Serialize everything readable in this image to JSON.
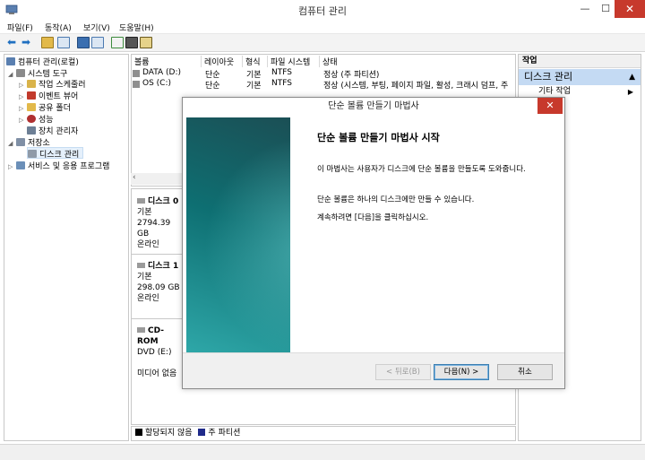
{
  "window": {
    "title": "컴퓨터 관리",
    "controls": {
      "minimize": "—",
      "maximize": "☐",
      "close": "✕"
    }
  },
  "menubar": [
    "파일(F)",
    "동작(A)",
    "보기(V)",
    "도움말(H)"
  ],
  "tree": {
    "root": "컴퓨터 관리(로컬)",
    "system_tools": "시스템 도구",
    "task_scheduler": "작업 스케줄러",
    "event_viewer": "이벤트 뷰어",
    "shared_folders": "공유 폴더",
    "performance": "성능",
    "device_manager": "장치 관리자",
    "storage": "저장소",
    "disk_management": "디스크 관리",
    "services": "서비스 및 응용 프로그램"
  },
  "volumes": {
    "columns": [
      "볼륨",
      "레이아웃",
      "형식",
      "파일 시스템",
      "상태"
    ],
    "rows": [
      {
        "name": "DATA (D:)",
        "layout": "단순",
        "type": "기본",
        "fs": "NTFS",
        "status": "정상 (주 파티션)"
      },
      {
        "name": "OS (C:)",
        "layout": "단순",
        "type": "기본",
        "fs": "NTFS",
        "status": "정상 (시스템, 부팅, 페이지 파일, 활성, 크래시 덤프, 주"
      }
    ]
  },
  "disks": [
    {
      "name": "디스크 0",
      "type": "기본",
      "size": "2794.39 GB",
      "state": "온라인"
    },
    {
      "name": "디스크 1",
      "type": "기본",
      "size": "298.09 GB",
      "state": "온라인"
    },
    {
      "name": "CD-ROM",
      "type": "DVD (E:)",
      "size": "",
      "state": "미디어 없음"
    }
  ],
  "legend": {
    "unallocated": "할당되지 않음",
    "primary": "주 파티션",
    "unallocated_color": "#000000",
    "primary_color": "#1f2a8a"
  },
  "actions": {
    "header": "작업",
    "section": "디스크 관리",
    "item": "기타 작업"
  },
  "wizard": {
    "title": "단순 볼륨 만들기 마법사",
    "heading": "단순 볼륨 만들기 마법사 시작",
    "p1": "이 마법사는 사용자가 디스크에 단순 볼륨을 만들도록 도와줍니다.",
    "p2": "단순 볼륨은 하나의 디스크에만 만들 수 있습니다.",
    "p3": "계속하려면 [다음]을 클릭하십시오.",
    "back": "< 뒤로(B)",
    "next": "다음(N) >",
    "cancel": "취소",
    "close": "✕"
  },
  "colors": {
    "accent": "#c4daf3",
    "close_red": "#c7392c",
    "teal": "#0e6f72"
  }
}
